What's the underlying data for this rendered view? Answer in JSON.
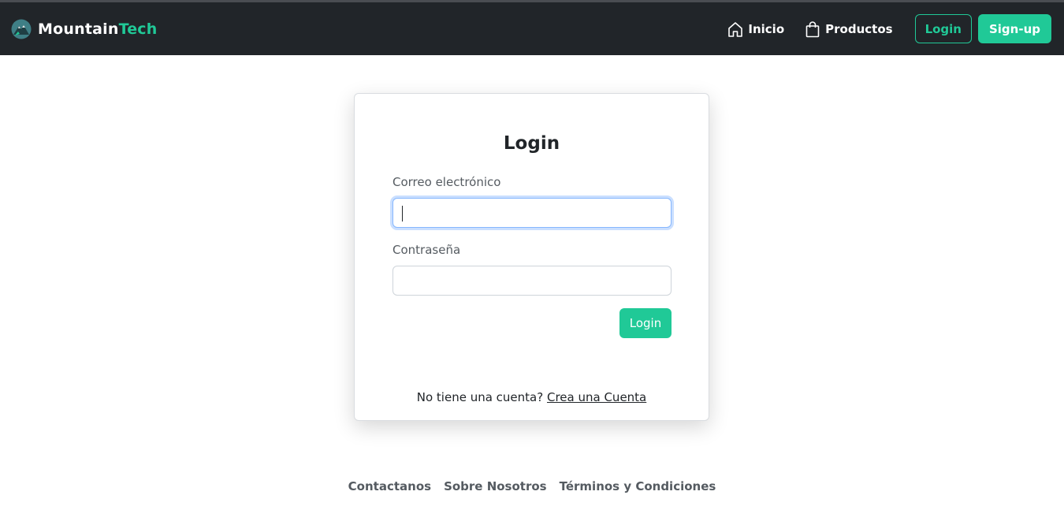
{
  "navbar": {
    "brand_first": "Mountain",
    "brand_second": "Tech",
    "links": [
      {
        "label": "Inicio",
        "icon": "home-icon"
      },
      {
        "label": "Productos",
        "icon": "shopping-bag-icon"
      }
    ],
    "login_label": "Login",
    "signup_label": "Sign-up"
  },
  "login_form": {
    "title": "Login",
    "email_label": "Correo electrónico",
    "email_value": "",
    "password_label": "Contraseña",
    "password_value": "",
    "submit_label": "Login",
    "no_account_text": "No tiene una cuenta?",
    "create_account_link": "Crea una Cuenta"
  },
  "footer": {
    "links": [
      "Contactanos",
      "Sobre Nosotros",
      "Términos y Condiciones"
    ]
  },
  "colors": {
    "navbar_bg": "#212529",
    "accent": "#20c997",
    "focus_ring": "#86b7fe"
  }
}
